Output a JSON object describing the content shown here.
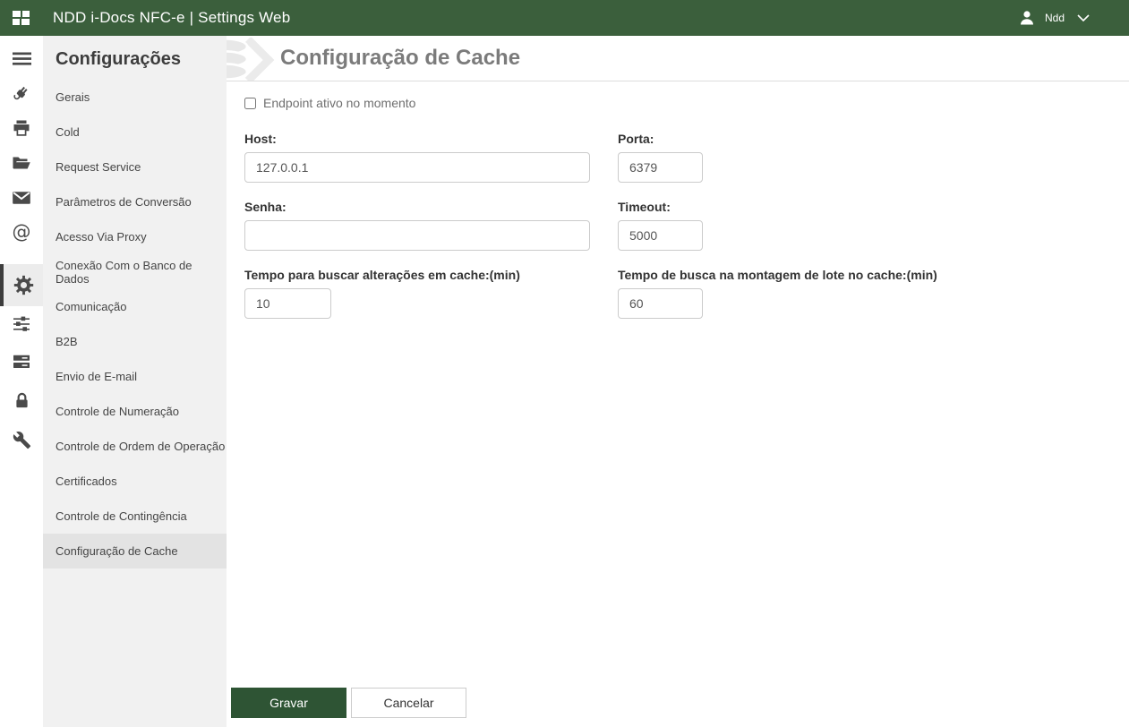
{
  "topbar": {
    "title": "NDD i-Docs NFC-e | Settings Web",
    "user_name": "Ndd"
  },
  "icon_rail": {
    "icons": [
      "hamburger-menu",
      "plug",
      "printer",
      "folder-open",
      "envelope",
      "at-sign",
      "gear",
      "sliders",
      "server",
      "lock",
      "wrench"
    ],
    "active_icon": "gear"
  },
  "sidebar": {
    "title": "Configurações",
    "items": [
      "Gerais",
      "Cold",
      "Request Service",
      "Parâmetros de Conversão",
      "Acesso Via Proxy",
      "Conexão Com o Banco de Dados",
      "Comunicação",
      "B2B",
      "Envio de E-mail",
      "Controle de Numeração",
      "Controle de Ordem de Operação",
      "Certificados",
      "Controle de Contingência",
      "Configuração de Cache"
    ],
    "active_item": "Configuração de Cache"
  },
  "main": {
    "title": "Configuração de Cache",
    "checkbox": {
      "label": "Endpoint ativo no momento",
      "checked": false
    },
    "fields": {
      "host": {
        "label": "Host:",
        "value": "127.0.0.1"
      },
      "porta": {
        "label": "Porta:",
        "value": "6379"
      },
      "senha": {
        "label": "Senha:",
        "value": ""
      },
      "timeout": {
        "label": "Timeout:",
        "value": "5000"
      },
      "tempo_buscar_alteracoes": {
        "label": "Tempo para buscar alterações em cache:(min)",
        "value": "10"
      },
      "tempo_busca_lote": {
        "label": "Tempo de busca na montagem de lote no cache:(min)",
        "value": "60"
      }
    },
    "buttons": {
      "save": "Gravar",
      "cancel": "Cancelar"
    }
  },
  "colors": {
    "topbar_green": "#3b5f3c",
    "button_green": "#2e5434",
    "sidebar_bg": "#f1f1f1",
    "sidebar_active_bg": "#e3e3e3",
    "rail_icon": "#4a4a4a",
    "title_gray": "#7b7b7b"
  }
}
